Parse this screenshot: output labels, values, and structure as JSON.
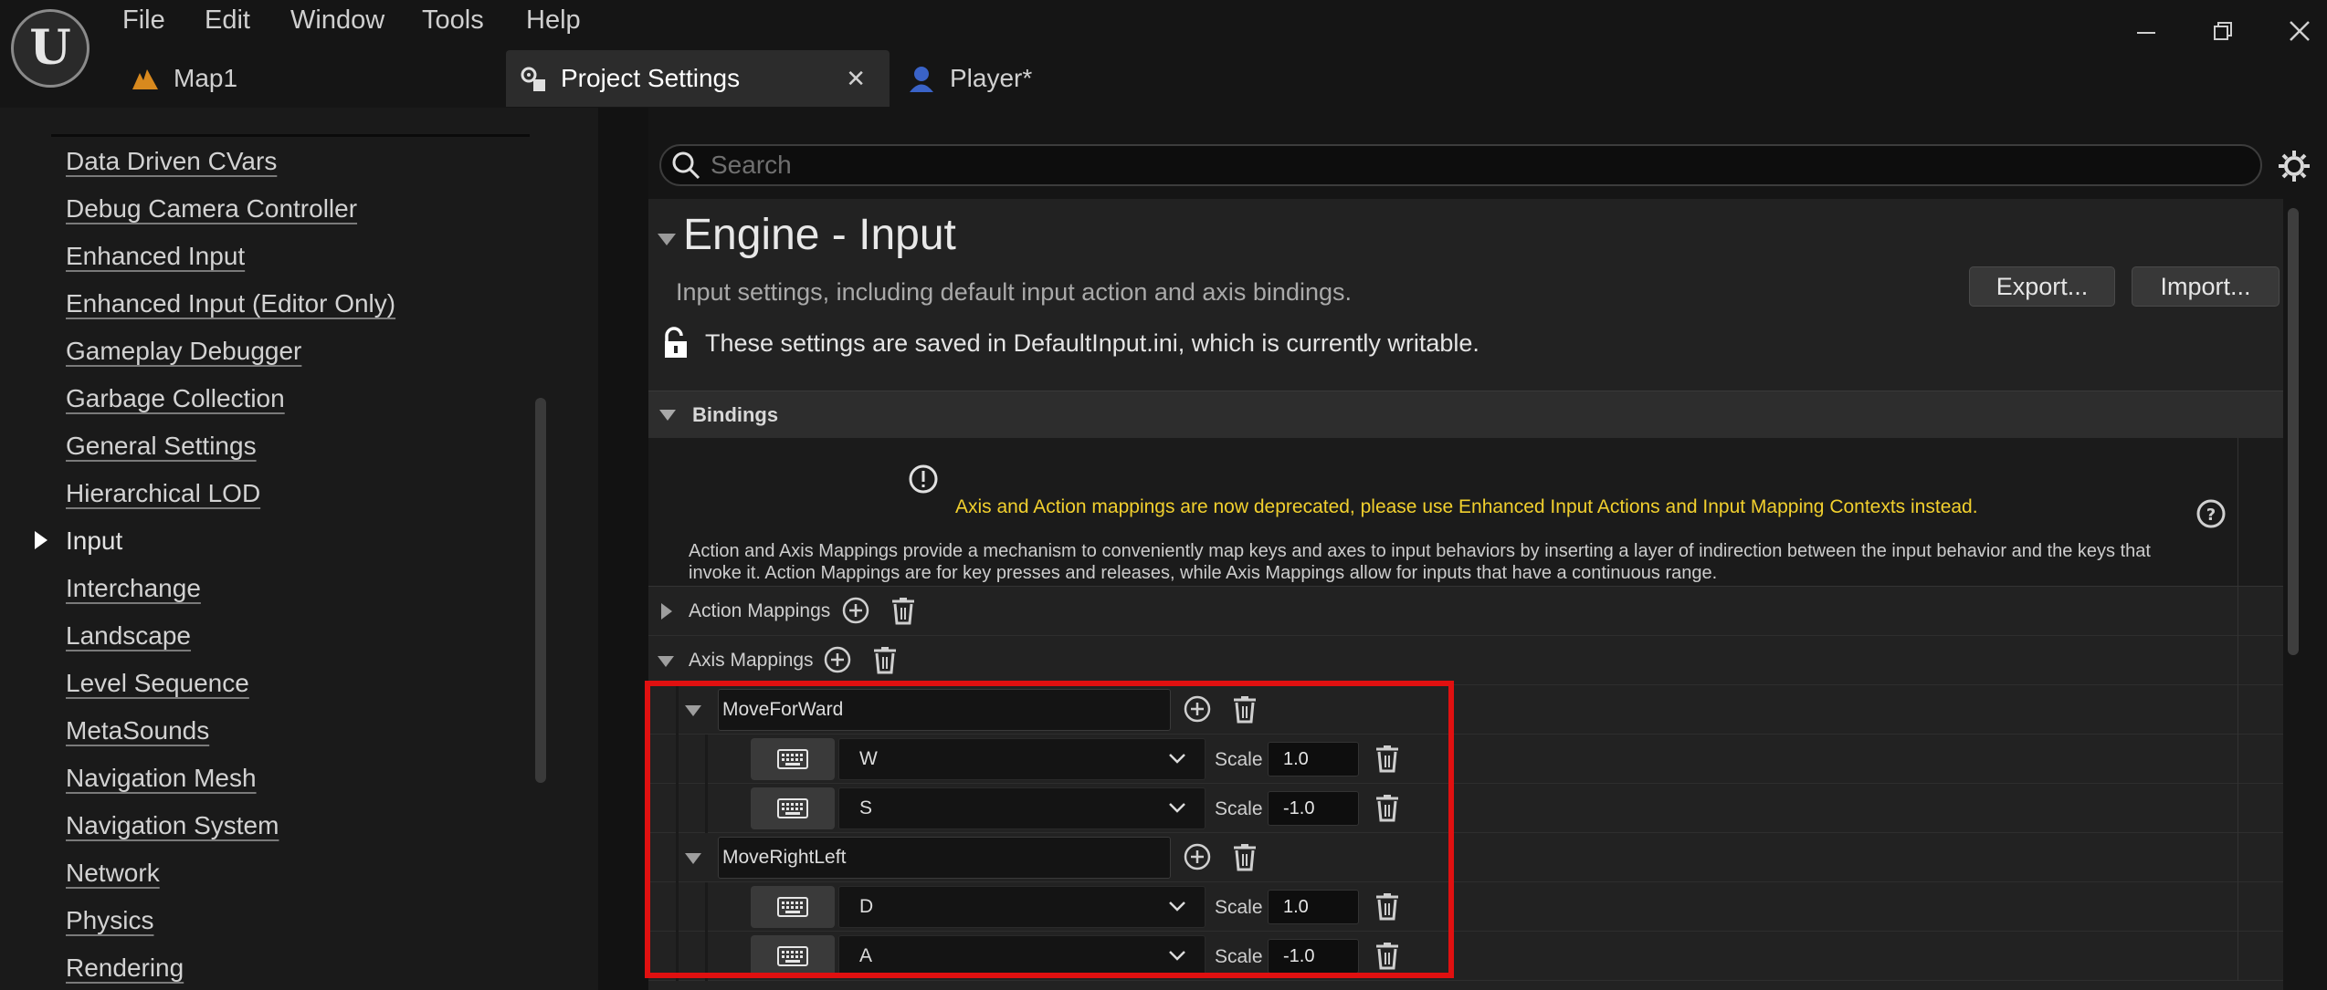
{
  "app": {
    "menu": [
      "File",
      "Edit",
      "Window",
      "Tools",
      "Help"
    ],
    "tabs": [
      {
        "label": "Map1",
        "icon": "level-icon"
      },
      {
        "label": "Project Settings",
        "icon": "settings-icon",
        "active": true
      },
      {
        "label": "Player*",
        "icon": "blueprint-pawn-icon"
      }
    ],
    "window_controls": [
      "minimize",
      "restore",
      "close"
    ]
  },
  "sidebar": {
    "items": [
      {
        "label": "Data Driven CVars"
      },
      {
        "label": "Debug Camera Controller"
      },
      {
        "label": "Enhanced Input"
      },
      {
        "label": "Enhanced Input (Editor Only)"
      },
      {
        "label": "Gameplay Debugger"
      },
      {
        "label": "Garbage Collection"
      },
      {
        "label": "General Settings"
      },
      {
        "label": "Hierarchical LOD"
      },
      {
        "label": "Input",
        "selected": true
      },
      {
        "label": "Interchange"
      },
      {
        "label": "Landscape"
      },
      {
        "label": "Level Sequence"
      },
      {
        "label": "MetaSounds"
      },
      {
        "label": "Navigation Mesh"
      },
      {
        "label": "Navigation System"
      },
      {
        "label": "Network"
      },
      {
        "label": "Physics"
      },
      {
        "label": "Rendering"
      }
    ]
  },
  "search": {
    "placeholder": "Search",
    "value": ""
  },
  "section": {
    "title": "Engine - Input",
    "description": "Input settings, including default input action and axis bindings.",
    "export_label": "Export...",
    "import_label": "Import...",
    "writable_note": "These settings are saved in DefaultInput.ini, which is currently writable."
  },
  "bindings": {
    "header": "Bindings",
    "warning": "Axis and Action mappings are now deprecated, please use Enhanced Input Actions and Input Mapping Contexts instead.",
    "description": "Action and Axis Mappings provide a mechanism to conveniently map keys and axes to input behaviors by inserting a layer of indirection between the input behavior and the keys that invoke it. Action Mappings are for key presses and releases, while Axis Mappings allow for inputs that have a continuous range.",
    "action_mappings_label": "Action Mappings",
    "axis_mappings_label": "Axis Mappings",
    "scale_label": "Scale",
    "axis_mappings": [
      {
        "name": "MoveForWard",
        "keys": [
          {
            "key": "W",
            "scale": "1.0"
          },
          {
            "key": "S",
            "scale": "-1.0"
          }
        ]
      },
      {
        "name": "MoveRightLeft",
        "keys": [
          {
            "key": "D",
            "scale": "1.0"
          },
          {
            "key": "A",
            "scale": "-1.0"
          }
        ]
      }
    ]
  },
  "colors": {
    "highlight": "#e01010",
    "warning_text": "#f2d02e",
    "background": "#151515"
  }
}
